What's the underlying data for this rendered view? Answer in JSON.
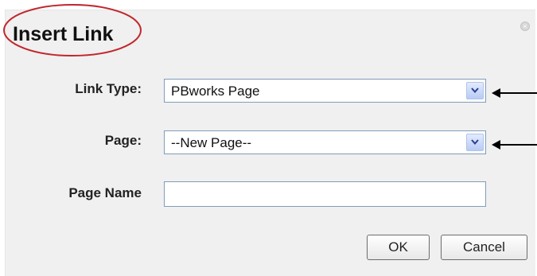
{
  "dialog": {
    "title": "Insert Link",
    "close_icon": "close-icon",
    "link_type": {
      "label": "Link Type:",
      "value": "PBworks Page"
    },
    "page": {
      "label": "Page:",
      "value": "--New Page--"
    },
    "page_name": {
      "label": "Page Name",
      "value": ""
    },
    "buttons": {
      "ok": "OK",
      "cancel": "Cancel"
    }
  },
  "annotations": {
    "highlight_color": "#c1272d",
    "arrow_color": "#000000"
  }
}
